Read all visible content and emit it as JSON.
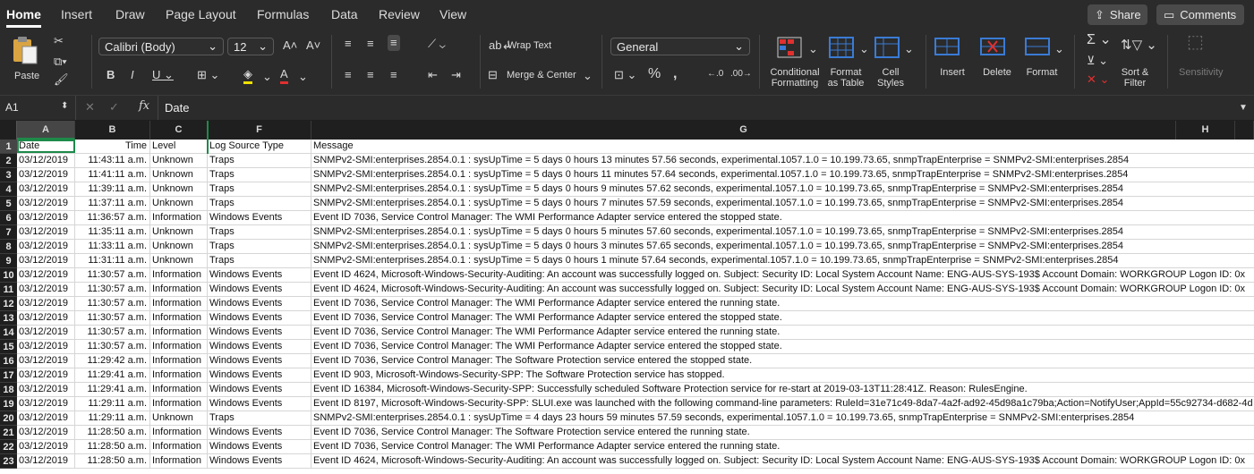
{
  "tabs": [
    {
      "label": "Home",
      "active": true
    },
    {
      "label": "Insert"
    },
    {
      "label": "Draw"
    },
    {
      "label": "Page Layout"
    },
    {
      "label": "Formulas"
    },
    {
      "label": "Data"
    },
    {
      "label": "Review"
    },
    {
      "label": "View"
    }
  ],
  "share_label": "Share",
  "comments_label": "Comments",
  "ribbon": {
    "paste": "Paste",
    "font_name": "Calibri (Body)",
    "font_size": "12",
    "wrap_text": "Wrap Text",
    "merge_center": "Merge & Center",
    "number_format": "General",
    "conditional": [
      "Conditional",
      "Formatting"
    ],
    "format_table": [
      "Format",
      "as Table"
    ],
    "cell_styles": [
      "Cell",
      "Styles"
    ],
    "insert": "Insert",
    "delete": "Delete",
    "format": "Format",
    "sort_filter": [
      "Sort &",
      "Filter"
    ],
    "sensitivity": "Sensitivity"
  },
  "formula_bar": {
    "name_box": "A1",
    "fx": "fx",
    "content": "Date"
  },
  "columns": [
    "A",
    "B",
    "C",
    "F",
    "G",
    "H"
  ],
  "rows": [
    {
      "n": "1",
      "a": "Date",
      "b": "Time",
      "c": "Level",
      "f": "Log Source Type",
      "g": "Message"
    },
    {
      "n": "2",
      "a": "03/12/2019",
      "b": "11:43:11 a.m.",
      "c": "Unknown",
      "f": "Traps",
      "g": "SNMPv2-SMI:enterprises.2854.0.1 : sysUpTime = 5 days 0 hours 13 minutes 57.56 seconds, experimental.1057.1.0 = 10.199.73.65, snmpTrapEnterprise = SNMPv2-SMI:enterprises.2854"
    },
    {
      "n": "3",
      "a": "03/12/2019",
      "b": "11:41:11 a.m.",
      "c": "Unknown",
      "f": "Traps",
      "g": "SNMPv2-SMI:enterprises.2854.0.1 : sysUpTime = 5 days 0 hours 11 minutes 57.64 seconds, experimental.1057.1.0 = 10.199.73.65, snmpTrapEnterprise = SNMPv2-SMI:enterprises.2854"
    },
    {
      "n": "4",
      "a": "03/12/2019",
      "b": "11:39:11 a.m.",
      "c": "Unknown",
      "f": "Traps",
      "g": "SNMPv2-SMI:enterprises.2854.0.1 : sysUpTime = 5 days 0 hours 9 minutes 57.62 seconds, experimental.1057.1.0 = 10.199.73.65, snmpTrapEnterprise = SNMPv2-SMI:enterprises.2854"
    },
    {
      "n": "5",
      "a": "03/12/2019",
      "b": "11:37:11 a.m.",
      "c": "Unknown",
      "f": "Traps",
      "g": "SNMPv2-SMI:enterprises.2854.0.1 : sysUpTime = 5 days 0 hours 7 minutes 57.59 seconds, experimental.1057.1.0 = 10.199.73.65, snmpTrapEnterprise = SNMPv2-SMI:enterprises.2854"
    },
    {
      "n": "6",
      "a": "03/12/2019",
      "b": "11:36:57 a.m.",
      "c": "Information",
      "f": "Windows Events",
      "g": "Event ID 7036, Service Control Manager: The WMI Performance Adapter service entered the stopped state."
    },
    {
      "n": "7",
      "a": "03/12/2019",
      "b": "11:35:11 a.m.",
      "c": "Unknown",
      "f": "Traps",
      "g": "SNMPv2-SMI:enterprises.2854.0.1 : sysUpTime = 5 days 0 hours 5 minutes 57.60 seconds, experimental.1057.1.0 = 10.199.73.65, snmpTrapEnterprise = SNMPv2-SMI:enterprises.2854"
    },
    {
      "n": "8",
      "a": "03/12/2019",
      "b": "11:33:11 a.m.",
      "c": "Unknown",
      "f": "Traps",
      "g": "SNMPv2-SMI:enterprises.2854.0.1 : sysUpTime = 5 days 0 hours 3 minutes 57.65 seconds, experimental.1057.1.0 = 10.199.73.65, snmpTrapEnterprise = SNMPv2-SMI:enterprises.2854"
    },
    {
      "n": "9",
      "a": "03/12/2019",
      "b": "11:31:11 a.m.",
      "c": "Unknown",
      "f": "Traps",
      "g": "SNMPv2-SMI:enterprises.2854.0.1 : sysUpTime = 5 days 0 hours 1 minute 57.64 seconds, experimental.1057.1.0 = 10.199.73.65, snmpTrapEnterprise = SNMPv2-SMI:enterprises.2854"
    },
    {
      "n": "10",
      "a": "03/12/2019",
      "b": "11:30:57 a.m.",
      "c": "Information",
      "f": "Windows Events",
      "g": "Event ID 4624, Microsoft-Windows-Security-Auditing: An account was successfully logged on.  Subject:  Security ID:  Local System  Account Name:  ENG-AUS-SYS-193$  Account Domain:  WORKGROUP  Logon ID:  0x"
    },
    {
      "n": "11",
      "a": "03/12/2019",
      "b": "11:30:57 a.m.",
      "c": "Information",
      "f": "Windows Events",
      "g": "Event ID 4624, Microsoft-Windows-Security-Auditing: An account was successfully logged on.  Subject:  Security ID:  Local System  Account Name:  ENG-AUS-SYS-193$  Account Domain:  WORKGROUP  Logon ID:  0x"
    },
    {
      "n": "12",
      "a": "03/12/2019",
      "b": "11:30:57 a.m.",
      "c": "Information",
      "f": "Windows Events",
      "g": "Event ID 7036, Service Control Manager: The WMI Performance Adapter service entered the running state."
    },
    {
      "n": "13",
      "a": "03/12/2019",
      "b": "11:30:57 a.m.",
      "c": "Information",
      "f": "Windows Events",
      "g": "Event ID 7036, Service Control Manager: The WMI Performance Adapter service entered the stopped state."
    },
    {
      "n": "14",
      "a": "03/12/2019",
      "b": "11:30:57 a.m.",
      "c": "Information",
      "f": "Windows Events",
      "g": "Event ID 7036, Service Control Manager: The WMI Performance Adapter service entered the running state."
    },
    {
      "n": "15",
      "a": "03/12/2019",
      "b": "11:30:57 a.m.",
      "c": "Information",
      "f": "Windows Events",
      "g": "Event ID 7036, Service Control Manager: The WMI Performance Adapter service entered the stopped state."
    },
    {
      "n": "16",
      "a": "03/12/2019",
      "b": "11:29:42 a.m.",
      "c": "Information",
      "f": "Windows Events",
      "g": "Event ID 7036, Service Control Manager: The Software Protection service entered the stopped state."
    },
    {
      "n": "17",
      "a": "03/12/2019",
      "b": "11:29:41 a.m.",
      "c": "Information",
      "f": "Windows Events",
      "g": "Event ID 903, Microsoft-Windows-Security-SPP: The Software Protection service has stopped."
    },
    {
      "n": "18",
      "a": "03/12/2019",
      "b": "11:29:41 a.m.",
      "c": "Information",
      "f": "Windows Events",
      "g": "Event ID 16384, Microsoft-Windows-Security-SPP: Successfully scheduled Software Protection service for re-start at 2019-03-13T11:28:41Z. Reason: RulesEngine."
    },
    {
      "n": "19",
      "a": "03/12/2019",
      "b": "11:29:11 a.m.",
      "c": "Information",
      "f": "Windows Events",
      "g": "Event ID 8197, Microsoft-Windows-Security-SPP: SLUI.exe was launched with the following command-line parameters: RuleId=31e71c49-8da7-4a2f-ad92-45d98a1c79ba;Action=NotifyUser;AppId=55c92734-d682-4d"
    },
    {
      "n": "20",
      "a": "03/12/2019",
      "b": "11:29:11 a.m.",
      "c": "Unknown",
      "f": "Traps",
      "g": "SNMPv2-SMI:enterprises.2854.0.1 : sysUpTime = 4 days 23 hours 59 minutes 57.59 seconds, experimental.1057.1.0 = 10.199.73.65, snmpTrapEnterprise = SNMPv2-SMI:enterprises.2854"
    },
    {
      "n": "21",
      "a": "03/12/2019",
      "b": "11:28:50 a.m.",
      "c": "Information",
      "f": "Windows Events",
      "g": "Event ID 7036, Service Control Manager: The Software Protection service entered the running state."
    },
    {
      "n": "22",
      "a": "03/12/2019",
      "b": "11:28:50 a.m.",
      "c": "Information",
      "f": "Windows Events",
      "g": "Event ID 7036, Service Control Manager: The WMI Performance Adapter service entered the running state."
    },
    {
      "n": "23",
      "a": "03/12/2019",
      "b": "11:28:50 a.m.",
      "c": "Information",
      "f": "Windows Events",
      "g": "Event ID 4624, Microsoft-Windows-Security-Auditing: An account was successfully logged on.  Subject:  Security ID:  Local System  Account Name:  ENG-AUS-SYS-193$  Account Domain:  WORKGROUP  Logon ID:  0x"
    }
  ],
  "colors": {
    "accent": "#1d8a4a",
    "header_bg": "#1f1f1f",
    "ribbon_bg": "#2b2b2b"
  }
}
